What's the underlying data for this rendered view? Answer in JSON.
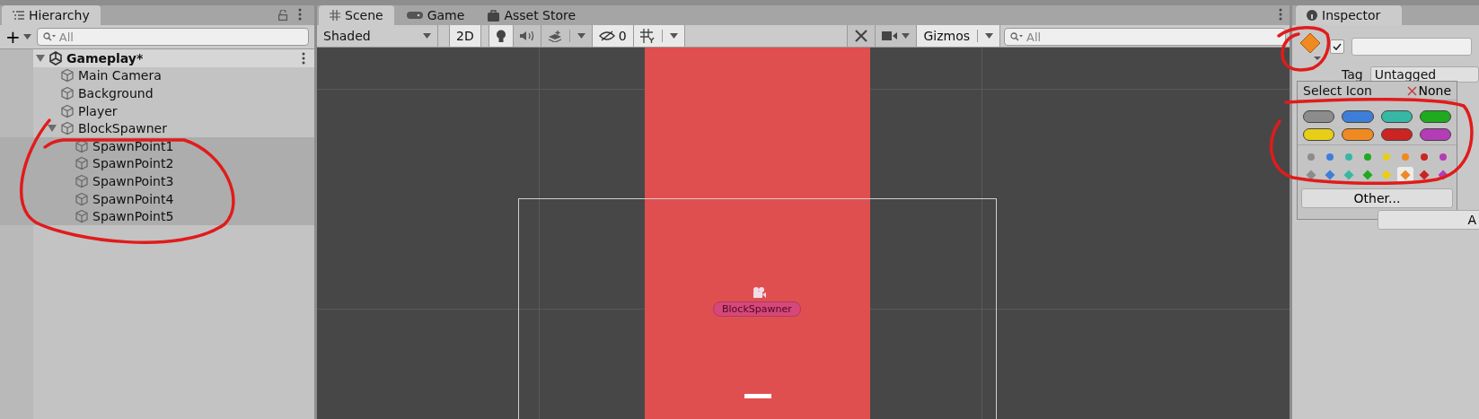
{
  "hierarchy": {
    "title": "Hierarchy",
    "add": "+",
    "search": {
      "placeholder": "All"
    },
    "tree": [
      {
        "label": "Gameplay*",
        "kind": "scene",
        "expanded": true,
        "children": [
          {
            "label": "Main Camera",
            "kind": "object"
          },
          {
            "label": "Background",
            "kind": "object"
          },
          {
            "label": "Player",
            "kind": "object"
          },
          {
            "label": "BlockSpawner",
            "kind": "object",
            "expanded": true,
            "children": [
              {
                "label": "SpawnPoint1",
                "kind": "object"
              },
              {
                "label": "SpawnPoint2",
                "kind": "object"
              },
              {
                "label": "SpawnPoint3",
                "kind": "object"
              },
              {
                "label": "SpawnPoint4",
                "kind": "object"
              },
              {
                "label": "SpawnPoint5",
                "kind": "object"
              }
            ]
          }
        ]
      }
    ]
  },
  "scene": {
    "tabs": [
      {
        "label": "Scene",
        "kind": "grid",
        "selected": true
      },
      {
        "label": "Game",
        "kind": "gamepad",
        "selected": false
      },
      {
        "label": "Asset Store",
        "kind": "bag",
        "selected": false
      }
    ],
    "toolbar": {
      "shading": "Shaded",
      "mode_2d": {
        "label": "2D",
        "on": true
      },
      "lighting_on": true,
      "audio_on": false,
      "hidden_count": "0",
      "gizmos": "Gizmos",
      "search": {
        "placeholder": "All"
      }
    },
    "view": {
      "label": "BlockSpawner"
    }
  },
  "inspector": {
    "title": "Inspector",
    "active": true,
    "checked": true,
    "tag_label": "Tag",
    "tag": "Untagged",
    "icon_popup": {
      "title": "Select Icon",
      "none": "None",
      "labels": [
        {
          "color": "#8c8c8c"
        },
        {
          "color": "#3f7ed8"
        },
        {
          "color": "#36b8a4"
        },
        {
          "color": "#1faa1f"
        },
        {
          "color": "#e6cf16"
        },
        {
          "color": "#ef8a22"
        },
        {
          "color": "#cc2323"
        },
        {
          "color": "#b43cb4"
        }
      ],
      "dots": [
        {
          "color": "#8c8c8c"
        },
        {
          "color": "#3f7ed8"
        },
        {
          "color": "#36b8a4"
        },
        {
          "color": "#1faa1f"
        },
        {
          "color": "#e6cf16"
        },
        {
          "color": "#ef8a22"
        },
        {
          "color": "#cc2323"
        },
        {
          "color": "#b43cb4"
        }
      ],
      "diamonds": [
        {
          "color": "#8c8c8c",
          "selected": false
        },
        {
          "color": "#3f7ed8",
          "selected": false
        },
        {
          "color": "#36b8a4",
          "selected": false
        },
        {
          "color": "#1faa1f",
          "selected": false
        },
        {
          "color": "#e6cf16",
          "selected": false
        },
        {
          "color": "#ef8a22",
          "selected": true
        },
        {
          "color": "#cc2323",
          "selected": false
        },
        {
          "color": "#b43cb4",
          "selected": false
        }
      ],
      "other": "Other..."
    },
    "add_button": "A"
  }
}
